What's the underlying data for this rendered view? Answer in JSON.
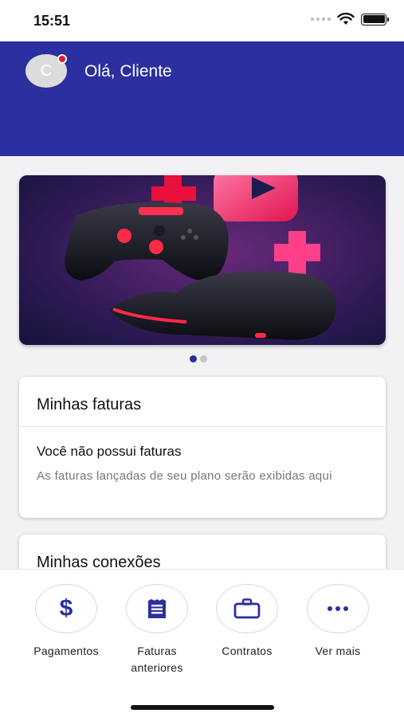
{
  "status_bar": {
    "time": "15:51"
  },
  "header": {
    "avatar_initial": "C",
    "greeting": "Olá, Cliente"
  },
  "carousel": {
    "page_count": 2,
    "active_index": 0
  },
  "faturas_card": {
    "title": "Minhas faturas",
    "empty_title": "Você não possui faturas",
    "empty_description": "As faturas lançadas de seu plano serão exibidas aqui"
  },
  "conexoes_card": {
    "title": "Minhas conexões"
  },
  "bottom_nav": {
    "items": [
      {
        "label": "Pagamentos",
        "icon": "dollar-icon"
      },
      {
        "label": "Faturas anteriores",
        "icon": "receipt-icon"
      },
      {
        "label": "Contratos",
        "icon": "briefcase-icon"
      },
      {
        "label": "Ver mais",
        "icon": "more-icon"
      }
    ]
  },
  "colors": {
    "primary": "#2b2fa0",
    "notification": "#e21b2b",
    "banner_bg": "#2a1845",
    "accent_pink": "#ff2d6f"
  }
}
